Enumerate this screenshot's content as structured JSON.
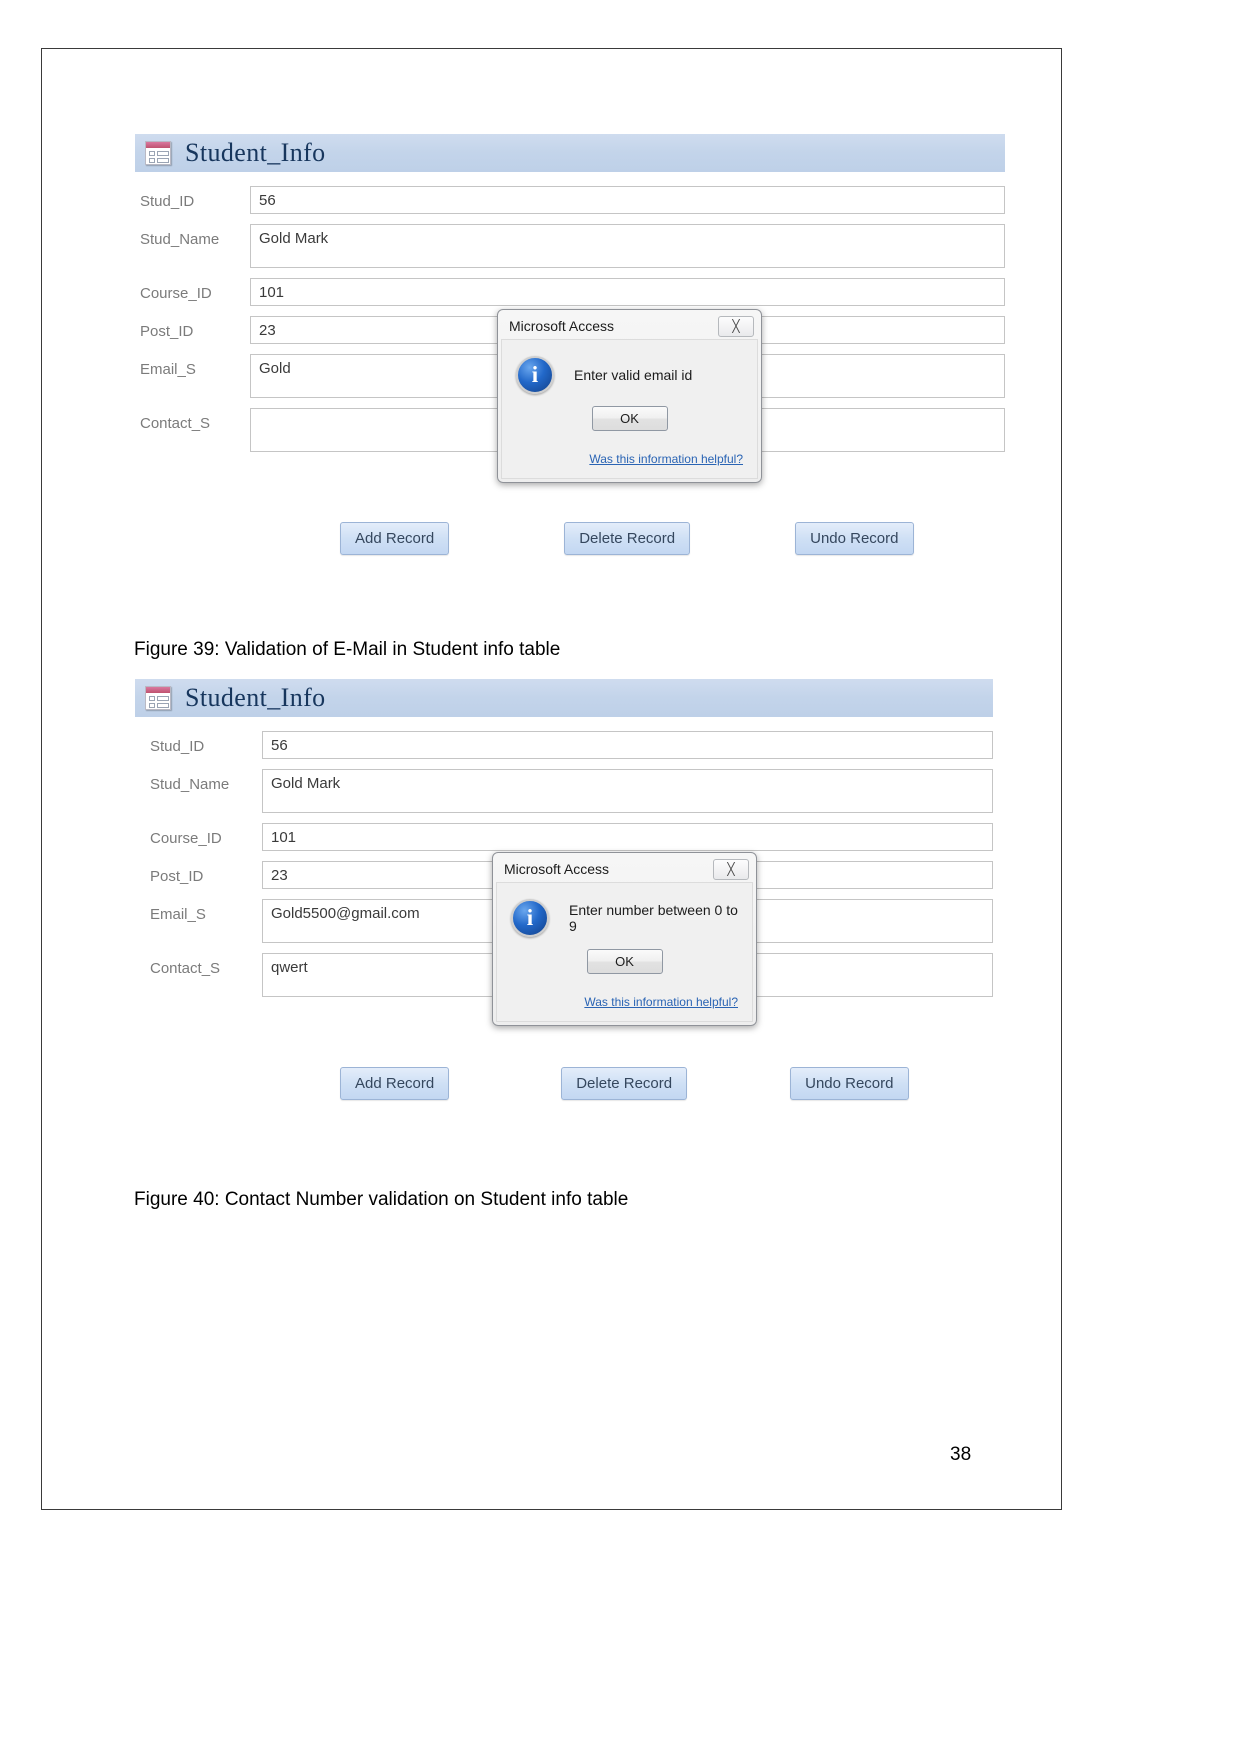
{
  "document": {
    "page_number": "38"
  },
  "figures": [
    {
      "caption": "Figure 39: Validation of E-Mail in Student info table",
      "form": {
        "title": "Student_Info",
        "icon": "access-form-icon",
        "fields": [
          {
            "label": "Stud_ID",
            "value": "56"
          },
          {
            "label": "Stud_Name",
            "value": "Gold Mark"
          },
          {
            "label": "Course_ID",
            "value": "101"
          },
          {
            "label": "Post_ID",
            "value": "23"
          },
          {
            "label": "Email_S",
            "value": "Gold"
          },
          {
            "label": "Contact_S",
            "value": ""
          }
        ],
        "buttons": [
          {
            "label": "Add Record"
          },
          {
            "label": "Delete Record"
          },
          {
            "label": "Undo Record"
          }
        ]
      },
      "dialog": {
        "title": "Microsoft Access",
        "close_glyph": "╳",
        "icon": "info-icon",
        "message": "Enter valid email id",
        "ok_label": "OK",
        "help_link": "Was this information helpful?"
      }
    },
    {
      "caption": "Figure 40: Contact Number validation on Student info table",
      "form": {
        "title": "Student_Info",
        "icon": "access-form-icon",
        "fields": [
          {
            "label": "Stud_ID",
            "value": "56"
          },
          {
            "label": "Stud_Name",
            "value": "Gold Mark"
          },
          {
            "label": "Course_ID",
            "value": "101"
          },
          {
            "label": "Post_ID",
            "value": "23"
          },
          {
            "label": "Email_S",
            "value": "Gold5500@gmail.com"
          },
          {
            "label": "Contact_S",
            "value": "qwert"
          }
        ],
        "buttons": [
          {
            "label": "Add Record"
          },
          {
            "label": "Delete Record"
          },
          {
            "label": "Undo Record"
          }
        ]
      },
      "dialog": {
        "title": "Microsoft Access",
        "close_glyph": "╳",
        "icon": "info-icon",
        "message": "Enter number between 0 to 9",
        "ok_label": "OK",
        "help_link": "Was this information helpful?"
      }
    }
  ],
  "colors": {
    "title_bar": "#c3d4ea",
    "title_text": "#17365d",
    "label_text": "#7b7b7b",
    "link": "#2a64b4",
    "button_face": "#cfe0f5"
  }
}
